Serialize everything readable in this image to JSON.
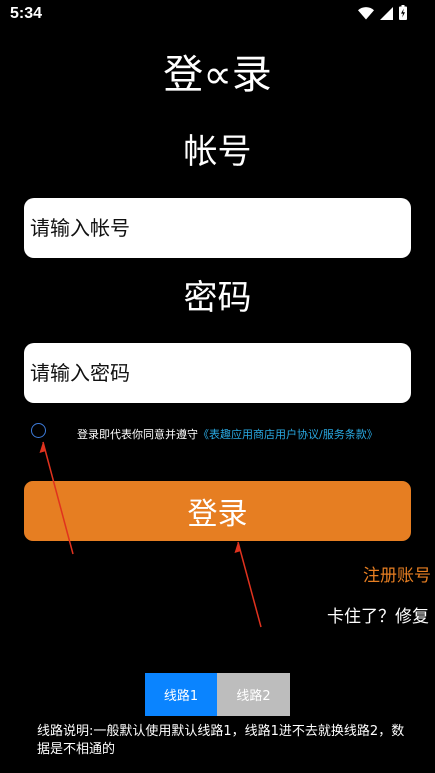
{
  "status_bar": {
    "time": "5:34",
    "icons": [
      "wifi-icon",
      "cellular-signal-icon",
      "battery-charging-icon"
    ]
  },
  "login": {
    "title": "登∝录",
    "account_label": "帐号",
    "account_placeholder": "请输入帐号",
    "password_label": "密码",
    "password_placeholder": "请输入密码",
    "agreement_prefix": "登录即代表你同意并遵守",
    "agreement_link": "《表趣应用商店用户协议/服务条款》",
    "login_button": "登录",
    "register_link": "注册账号",
    "stuck_link": "卡住了？修复"
  },
  "lines": {
    "tabs": [
      {
        "label": "线路1",
        "active": true
      },
      {
        "label": "线路2",
        "active": false
      }
    ],
    "note": "线路说明:一般默认使用默认线路1，线路1进不去就换线路2，数据是不相通的"
  },
  "colors": {
    "background": "#000000",
    "accent_orange": "#e67e22",
    "tab_active": "#0a84ff",
    "tab_inactive": "#bdbdbd",
    "link_blue": "#29a7e0",
    "annotation_arrow": "#e0321e"
  }
}
